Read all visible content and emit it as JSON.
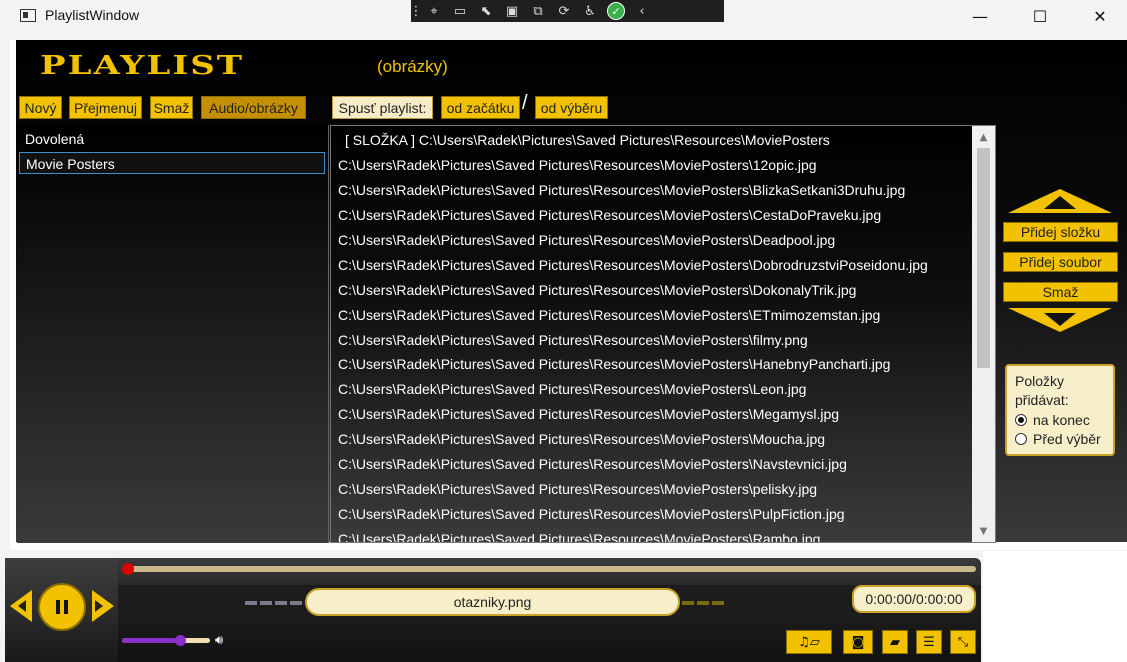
{
  "window": {
    "title": "PlaylistWindow",
    "minimize": "—",
    "maximize": "☐",
    "close": "✕"
  },
  "header": {
    "logo": "PLAYLIST",
    "subtitle": "(obrázky)"
  },
  "toolbar": {
    "new": "Nový",
    "rename": "Přejmenuj",
    "delete": "Smaž",
    "mode": "Audio/obrázky",
    "start_label": "Spusť playlist:",
    "from_start": "od začátku",
    "slash": "/",
    "from_selection": "od výběru"
  },
  "playlists": [
    "Dovolená",
    "Movie Posters"
  ],
  "files": [
    "[ SLOŽKA ] C:\\Users\\Radek\\Pictures\\Saved Pictures\\Resources\\MoviePosters",
    "C:\\Users\\Radek\\Pictures\\Saved Pictures\\Resources\\MoviePosters\\12opic.jpg",
    "C:\\Users\\Radek\\Pictures\\Saved Pictures\\Resources\\MoviePosters\\BlizkaSetkani3Druhu.jpg",
    "C:\\Users\\Radek\\Pictures\\Saved Pictures\\Resources\\MoviePosters\\CestaDoPraveku.jpg",
    "C:\\Users\\Radek\\Pictures\\Saved Pictures\\Resources\\MoviePosters\\Deadpool.jpg",
    "C:\\Users\\Radek\\Pictures\\Saved Pictures\\Resources\\MoviePosters\\DobrodruzstviPoseidonu.jpg",
    "C:\\Users\\Radek\\Pictures\\Saved Pictures\\Resources\\MoviePosters\\DokonalyTrik.jpg",
    "C:\\Users\\Radek\\Pictures\\Saved Pictures\\Resources\\MoviePosters\\ETmimozemstan.jpg",
    "C:\\Users\\Radek\\Pictures\\Saved Pictures\\Resources\\MoviePosters\\filmy.png",
    "C:\\Users\\Radek\\Pictures\\Saved Pictures\\Resources\\MoviePosters\\HanebnyPancharti.jpg",
    "C:\\Users\\Radek\\Pictures\\Saved Pictures\\Resources\\MoviePosters\\Leon.jpg",
    "C:\\Users\\Radek\\Pictures\\Saved Pictures\\Resources\\MoviePosters\\Megamysl.jpg",
    "C:\\Users\\Radek\\Pictures\\Saved Pictures\\Resources\\MoviePosters\\Moucha.jpg",
    "C:\\Users\\Radek\\Pictures\\Saved Pictures\\Resources\\MoviePosters\\Navstevnici.jpg",
    "C:\\Users\\Radek\\Pictures\\Saved Pictures\\Resources\\MoviePosters\\pelisky.jpg",
    "C:\\Users\\Radek\\Pictures\\Saved Pictures\\Resources\\MoviePosters\\PulpFiction.jpg",
    "C:\\Users\\Radek\\Pictures\\Saved Pictures\\Resources\\MoviePosters\\Rambo.jpg"
  ],
  "side": {
    "add_folder": "Přidej složku",
    "add_file": "Přidej soubor",
    "delete": "Smaž",
    "options_title": "Položky přidávat:",
    "opt_end": "na konec",
    "opt_before": "Před výběr"
  },
  "player": {
    "now_playing": "otazniky.png",
    "time": "0:00:00/0:00:00",
    "volume_level": 0.67,
    "progress": 0.0
  },
  "colors": {
    "accent": "#f2c200",
    "volume": "#8b2fc9",
    "progress_dot": "#dd0000"
  }
}
